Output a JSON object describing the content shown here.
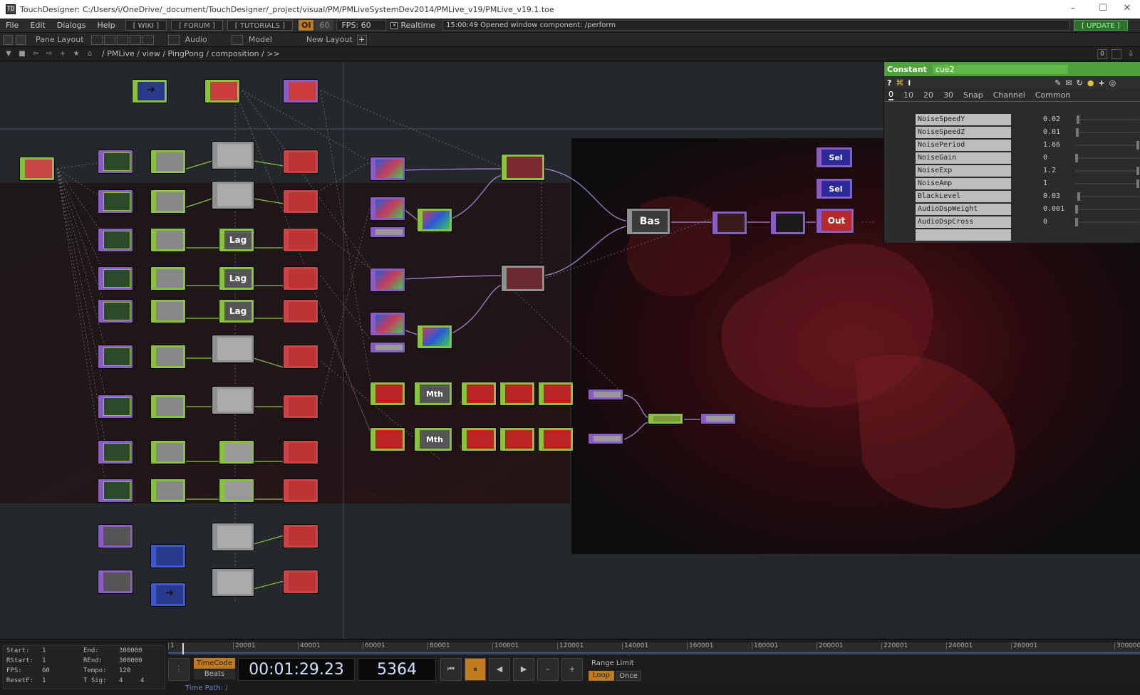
{
  "window": {
    "title": "TouchDesigner: C:/Users/i/OneDrive/_document/TouchDesigner/_project/visual/PM/PMLiveSystemDev2014/PMLive_v19/PMLive_v19.1.toe",
    "minimize": "–",
    "maximize": "☐",
    "close": "✕"
  },
  "menu": {
    "items": [
      "File",
      "Edit",
      "Dialogs",
      "Help"
    ],
    "wiki": "[ WIKI ]",
    "forum": "[ FORUM ]",
    "tutorials": "[ TUTORIALS ]",
    "oi": "OI",
    "fps_setting": "60",
    "fps_label": "FPS:",
    "fps_value": "60",
    "realtime": "Realtime",
    "message": "15:00:49 Opened window component: /perform",
    "update": "[ UPDATE ]"
  },
  "panebar": {
    "pane_layout": "Pane Layout",
    "audio": "Audio",
    "model": "Model",
    "new_layout": "New Layout",
    "add": "+",
    "right_value": "0"
  },
  "pathbar": {
    "path": "/ PMLive / view / PingPong / composition / >>"
  },
  "nodes": {
    "lag": "Lag",
    "mth": "Mth",
    "bas": "Bas",
    "sel": "Sel",
    "out": "Out"
  },
  "params": {
    "type": "Constant",
    "name": "cue2",
    "tabs": [
      "0",
      "10",
      "20",
      "30",
      "Snap",
      "Channel",
      "Common"
    ],
    "rows": [
      {
        "name": "NoiseSpeedY",
        "value": "0.02",
        "level": 0.02
      },
      {
        "name": "NoiseSpeedZ",
        "value": "0.01",
        "level": 0.01
      },
      {
        "name": "NoisePeriod",
        "value": "1.66",
        "level": 1.0
      },
      {
        "name": "NoiseGain",
        "value": "0",
        "level": 0.0
      },
      {
        "name": "NoiseExp",
        "value": "1.2",
        "level": 1.0
      },
      {
        "name": "NoiseAmp",
        "value": "1",
        "level": 1.0
      },
      {
        "name": "BlackLevel",
        "value": "0.03",
        "level": 0.03
      },
      {
        "name": "AudioDspWeight",
        "value": "0.001",
        "level": 0.001
      },
      {
        "name": "AudioDspCross",
        "value": "0",
        "level": 0.0
      }
    ]
  },
  "timeline": {
    "stats": {
      "start_label": "Start:",
      "start": "1",
      "end_label": "End:",
      "end": "300000",
      "rstart_label": "RStart:",
      "rstart": "1",
      "rend_label": "REnd:",
      "rend": "300000",
      "fps_label": "FPS:",
      "fps": "60",
      "tempo_label": "Tempo:",
      "tempo": "120",
      "resetf_label": "ResetF:",
      "resetf": "1",
      "tsig_label": "T Sig:",
      "tsig_a": "4",
      "tsig_b": "4"
    },
    "ticks": [
      "1",
      "20001",
      "40001",
      "60001",
      "80001",
      "100001",
      "120001",
      "140001",
      "160001",
      "180001",
      "200001",
      "220001",
      "240001",
      "260001",
      "300000"
    ],
    "timecode_btn": "TimeCode",
    "beats_btn": "Beats",
    "timecode": "00:01:29.23",
    "frame": "5364",
    "range_limit": "Range Limit",
    "loop": "Loop",
    "once": "Once",
    "time_path": "Time Path: /"
  },
  "colors": {
    "chop": "#8ac23d",
    "top": "#8a5cc4",
    "sop": "#3e5ac8",
    "dat": "#c84646",
    "accent_orange": "#c07a20"
  }
}
